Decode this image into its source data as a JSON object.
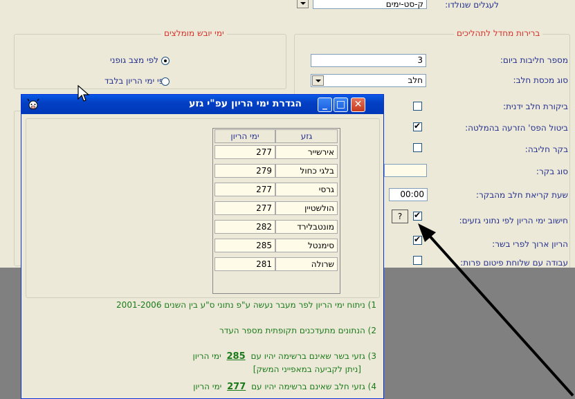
{
  "top_row": {
    "label": "לעגלים שנולדו:",
    "value": "ק-סט-ימים"
  },
  "process_group": {
    "title": "ברירות מחדל לתהליכים",
    "rows": [
      {
        "label": "מספר חליבות ביום:",
        "value": "3"
      },
      {
        "label": "סוג מכסת חלב:",
        "value": "חלב"
      },
      {
        "label": "ביקורת חלב ידנית:"
      },
      {
        "label": "ביטול הפס' הזרעה בהמלטה:"
      },
      {
        "label": "בקר חליבה:"
      },
      {
        "label": "סוג בקר:"
      },
      {
        "label": "שעת קריאת חלב מהבקר:",
        "value": "00:00"
      },
      {
        "label": "חישוב ימי הריון לפי נתוני גזעים:",
        "help": "?"
      },
      {
        "label": "הריון ארוך לפרי בשר:"
      },
      {
        "label": "עבודה עם שלוחת פיטום פרות:"
      }
    ],
    "checkbox_states": {
      "manual_milk": false,
      "cancel_insem": true,
      "milking_cattle": false,
      "breed_calc": true,
      "long_preg": true,
      "fattening": false
    }
  },
  "dry_group": {
    "title": "ימי יובש מומלצים",
    "options": [
      {
        "label": "לפי מצב גופני",
        "selected": true
      },
      {
        "label": "לפי ימי הריון בלבד",
        "selected": false
      }
    ]
  },
  "dialog": {
    "title": "הגדרת ימי הריון עפ\"י גזע",
    "headers": {
      "breed": "גזע",
      "days": "ימי הריון"
    },
    "rows": [
      {
        "breed": "אירשייר",
        "days": "277"
      },
      {
        "breed": "בלגי כחול",
        "days": "279"
      },
      {
        "breed": "גרסי",
        "days": "277"
      },
      {
        "breed": "הולשטיין",
        "days": "277"
      },
      {
        "breed": "מונטבלירד",
        "days": "282"
      },
      {
        "breed": "סימנטל",
        "days": "285"
      },
      {
        "breed": "שרולה",
        "days": "281"
      }
    ],
    "notes": {
      "n1": "1)  ניתוח ימי הריון לפר מעבר נעשה ע\"פ נתוני ס\"ע בין השנים 2001-2006",
      "n2": "2)  הנתונים מתעדכנים תקופתית מספר העדר",
      "n3_prefix": "3)  גזעי בשר שאינם ברשימה יהיו עם",
      "n3_value": "285",
      "n3_suffix": "ימי הריון",
      "n3_sub": "[ניתן לקביעה במאפייני המשק]",
      "n4_prefix": "4)  גזעי חלב שאינם ברשימה יהיו עם",
      "n4_value": "277",
      "n4_suffix": "ימי הריון"
    }
  },
  "colors": {
    "bg": "#ece9d8",
    "group_title": "#d7312a",
    "label": "#25308f",
    "note_green": "#1a7a1a",
    "gray_area": "#808080"
  }
}
